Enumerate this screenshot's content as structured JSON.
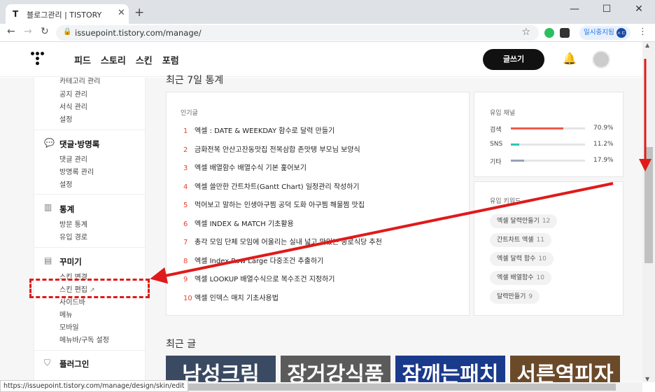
{
  "browser": {
    "tab_title": "블로그관리 | TISTORY",
    "favicon": "T",
    "new_tab": "+",
    "url": "issuepoint.tistory.com/manage/",
    "pause_label": "일시중지됨",
    "profile_initial": "ㅅㄷ",
    "window_controls": [
      "—",
      "☐",
      "✕"
    ],
    "status_url": "https://issuepoint.tistory.com/manage/design/skin/edit"
  },
  "header": {
    "nav": [
      "피드",
      "스토리",
      "스킨",
      "포럼"
    ],
    "write_label": "글쓰기"
  },
  "sidebar": {
    "group1_items": [
      "카테고리 관리",
      "공지 관리",
      "서식 관리",
      "설정"
    ],
    "comments": {
      "title": "댓글·방명록",
      "items": [
        "댓글 관리",
        "방명록 관리",
        "설정"
      ]
    },
    "stats": {
      "title": "통계",
      "items": [
        "방문 통계",
        "유입 경로"
      ]
    },
    "decorate": {
      "title": "꾸미기",
      "items": [
        "스킨 변경",
        "스킨 편집",
        "사이드바",
        "메뉴",
        "모바일",
        "메뉴바/구독 설정"
      ]
    },
    "plugin": {
      "title": "플러그인"
    }
  },
  "main": {
    "stats_title": "최근 7일 통계",
    "popular_label": "인기글",
    "popular": [
      {
        "rank": "1",
        "title": "엑셀 : DATE & WEEKDAY 함수로 달력 만들기"
      },
      {
        "rank": "2",
        "title": "금화전복 안산고잔동맛집 전복삼합 존맛탱 부모님 보양식"
      },
      {
        "rank": "3",
        "title": "엑셀 배열함수 배열수식 기본 훑어보기"
      },
      {
        "rank": "4",
        "title": "엑셀 쓸만한 간트차트(Gantt Chart) 일정관리 작성하기"
      },
      {
        "rank": "5",
        "title": "먹어보고 말하는 인생아구찜 공덕 도화 아구찜 해물찜 맛집"
      },
      {
        "rank": "6",
        "title": "엑셀 INDEX & MATCH 기초활용"
      },
      {
        "rank": "7",
        "title": "총각 모임 단체 모임에 어울리는 실내 넓고 맛있는 종로식당 추천"
      },
      {
        "rank": "8",
        "title": "엑셀 Index Row Large 다중조건 추출하기"
      },
      {
        "rank": "9",
        "title": "엑셀 LOOKUP 배열수식으로 복수조건 지정하기"
      },
      {
        "rank": "10",
        "title": "엑셀 인덱스 매치 기초사용법"
      }
    ],
    "channel_label": "유입 채널",
    "channels": [
      {
        "name": "검색",
        "pct": "70.9%",
        "value": 70.9,
        "color": "#ef5a4b"
      },
      {
        "name": "SNS",
        "pct": "11.2%",
        "value": 11.2,
        "color": "#2fc5b5"
      },
      {
        "name": "기타",
        "pct": "17.9%",
        "value": 17.9,
        "color": "#9aa0b5"
      }
    ],
    "keyword_label": "유입 키워드",
    "keywords": [
      {
        "word": "엑셀 달력만들기",
        "count": "12"
      },
      {
        "word": "간트차트 엑셀",
        "count": "11"
      },
      {
        "word": "엑셀 달력 함수",
        "count": "10"
      },
      {
        "word": "엑셀 배열함수",
        "count": "10"
      },
      {
        "word": "달력만들기",
        "count": "9"
      }
    ],
    "recent_title": "최근 글",
    "thumbnails": [
      {
        "text": "남성크림",
        "bg": "#3a4a63"
      },
      {
        "text": "장거강식품",
        "bg": "#5b5b5b"
      },
      {
        "text": "잠깨는패치",
        "bg": "#1a3a8c"
      },
      {
        "text": "서른역피자",
        "bg": "#6b4a2a"
      }
    ]
  },
  "annotation_color": "#e01a1a"
}
